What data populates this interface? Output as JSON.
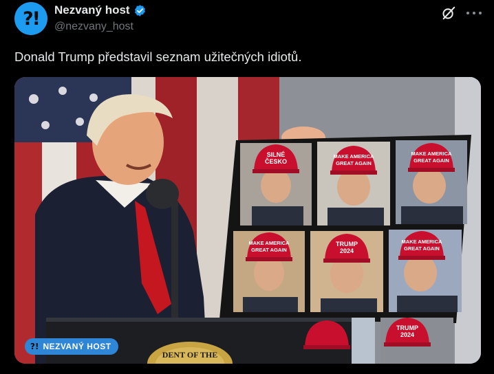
{
  "account": {
    "avatar_mark": "?!",
    "display_name": "Nezvaný host",
    "handle": "@nezvany_host",
    "verified_color": "#1d9bf0"
  },
  "tweet": {
    "text": "Donald Trump představil seznam užitečných idiotů."
  },
  "media": {
    "watermark_mark": "?!",
    "watermark_text": "NEZVANÝ HOST",
    "seal_text": "DENT OF THE",
    "board_caps": [
      {
        "lines": [
          "SILNÉ",
          "ČESKO"
        ]
      },
      {
        "lines": [
          "MAKE AMERICA",
          "GREAT AGAIN"
        ]
      },
      {
        "lines": [
          "MAKE AMERICA",
          "GREAT AGAIN"
        ]
      },
      {
        "lines": [
          "MAKE AMERICA",
          "GREAT AGAIN"
        ]
      },
      {
        "lines": [
          "TRUMP",
          "2024"
        ]
      },
      {
        "lines": [
          "MAKE AMERICA",
          "GREAT AGAIN"
        ]
      },
      {
        "lines": [
          "",
          ""
        ]
      },
      {
        "lines": [
          "",
          ""
        ]
      },
      {
        "lines": [
          "TRUMP",
          "2024"
        ]
      }
    ]
  },
  "icons": {
    "verified": "verified-badge-icon",
    "grok": "grok-icon",
    "more": "more-options-icon"
  },
  "colors": {
    "background": "#000000",
    "text_primary": "#e7e9ea",
    "text_secondary": "#71767b",
    "accent": "#1d9bf0",
    "maga_red": "#c8102e"
  }
}
